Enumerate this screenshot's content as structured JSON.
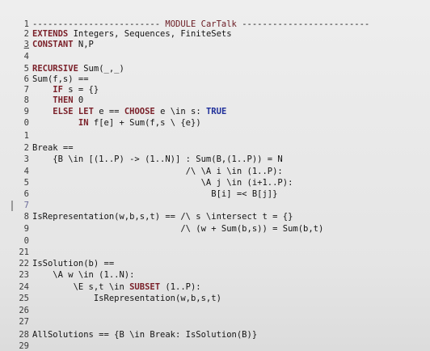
{
  "editor": {
    "lines": [
      {
        "n": "1",
        "segs": [
          {
            "t": "------------------------- "
          },
          {
            "t": "MODULE CarTalk",
            "k": "hdr"
          },
          {
            "t": " -------------------------"
          }
        ]
      },
      {
        "n": "2",
        "segs": [
          {
            "t": "EXTENDS",
            "k": "kw"
          },
          {
            "t": " Integers, Sequences, FiniteSets"
          }
        ]
      },
      {
        "n": "3",
        "u": true,
        "segs": [
          {
            "t": "CONSTANT",
            "k": "kw"
          },
          {
            "t": " N,P"
          }
        ]
      },
      {
        "n": "4",
        "segs": []
      },
      {
        "n": "5",
        "segs": [
          {
            "t": "RECURSIVE",
            "k": "kw"
          },
          {
            "t": " Sum(_,_)"
          }
        ]
      },
      {
        "n": "6",
        "segs": [
          {
            "t": "Sum(f,s) =="
          }
        ]
      },
      {
        "n": "7",
        "segs": [
          {
            "t": "    "
          },
          {
            "t": "IF",
            "k": "kw"
          },
          {
            "t": " s = {}"
          }
        ]
      },
      {
        "n": "8",
        "segs": [
          {
            "t": "    "
          },
          {
            "t": "THEN",
            "k": "kw"
          },
          {
            "t": " 0"
          }
        ]
      },
      {
        "n": "9",
        "segs": [
          {
            "t": "    "
          },
          {
            "t": "ELSE",
            "k": "kw"
          },
          {
            "t": " "
          },
          {
            "t": "LET",
            "k": "kw"
          },
          {
            "t": " e == "
          },
          {
            "t": "CHOOSE",
            "k": "kw"
          },
          {
            "t": " e \\in s: "
          },
          {
            "t": "TRUE",
            "k": "bl"
          }
        ]
      },
      {
        "n": "0",
        "segs": [
          {
            "t": "         "
          },
          {
            "t": "IN",
            "k": "kw"
          },
          {
            "t": " f[e] + Sum(f,s \\ {e})"
          }
        ]
      },
      {
        "n": "1",
        "segs": []
      },
      {
        "n": "2",
        "segs": [
          {
            "t": "Break =="
          }
        ]
      },
      {
        "n": "3",
        "segs": [
          {
            "t": "    {B \\in [(1..P) -> (1..N)] : Sum(B,(1..P)) = N"
          }
        ]
      },
      {
        "n": "4",
        "segs": [
          {
            "t": "                              /\\ \\A i \\in (1..P):"
          }
        ]
      },
      {
        "n": "5",
        "segs": [
          {
            "t": "                                 \\A j \\in (i+1..P):"
          }
        ]
      },
      {
        "n": "6",
        "segs": [
          {
            "t": "                                   B[i] =< B[j]}"
          }
        ]
      },
      {
        "n": "7",
        "m": true,
        "segs": []
      },
      {
        "n": "8",
        "segs": [
          {
            "t": "IsRepresentation(w,b,s,t) == /\\ s \\intersect t = {}"
          }
        ]
      },
      {
        "n": "9",
        "segs": [
          {
            "t": "                             /\\ (w + Sum(b,s)) = Sum(b,t)"
          }
        ]
      },
      {
        "n": "0",
        "segs": []
      },
      {
        "n": "21",
        "segs": []
      },
      {
        "n": "22",
        "segs": [
          {
            "t": "IsSolution(b) =="
          }
        ]
      },
      {
        "n": "23",
        "segs": [
          {
            "t": "    \\A w \\in (1..N):"
          }
        ]
      },
      {
        "n": "24",
        "segs": [
          {
            "t": "        \\E s,t \\in "
          },
          {
            "t": "SUBSET",
            "k": "kw"
          },
          {
            "t": " (1..P):"
          }
        ]
      },
      {
        "n": "25",
        "segs": [
          {
            "t": "            IsRepresentation(w,b,s,t)"
          }
        ]
      },
      {
        "n": "26",
        "segs": []
      },
      {
        "n": "27",
        "segs": []
      },
      {
        "n": "28",
        "segs": [
          {
            "t": "AllSolutions == {B \\in Break: IsSolution(B)}"
          }
        ]
      },
      {
        "n": "29",
        "segs": []
      }
    ]
  }
}
